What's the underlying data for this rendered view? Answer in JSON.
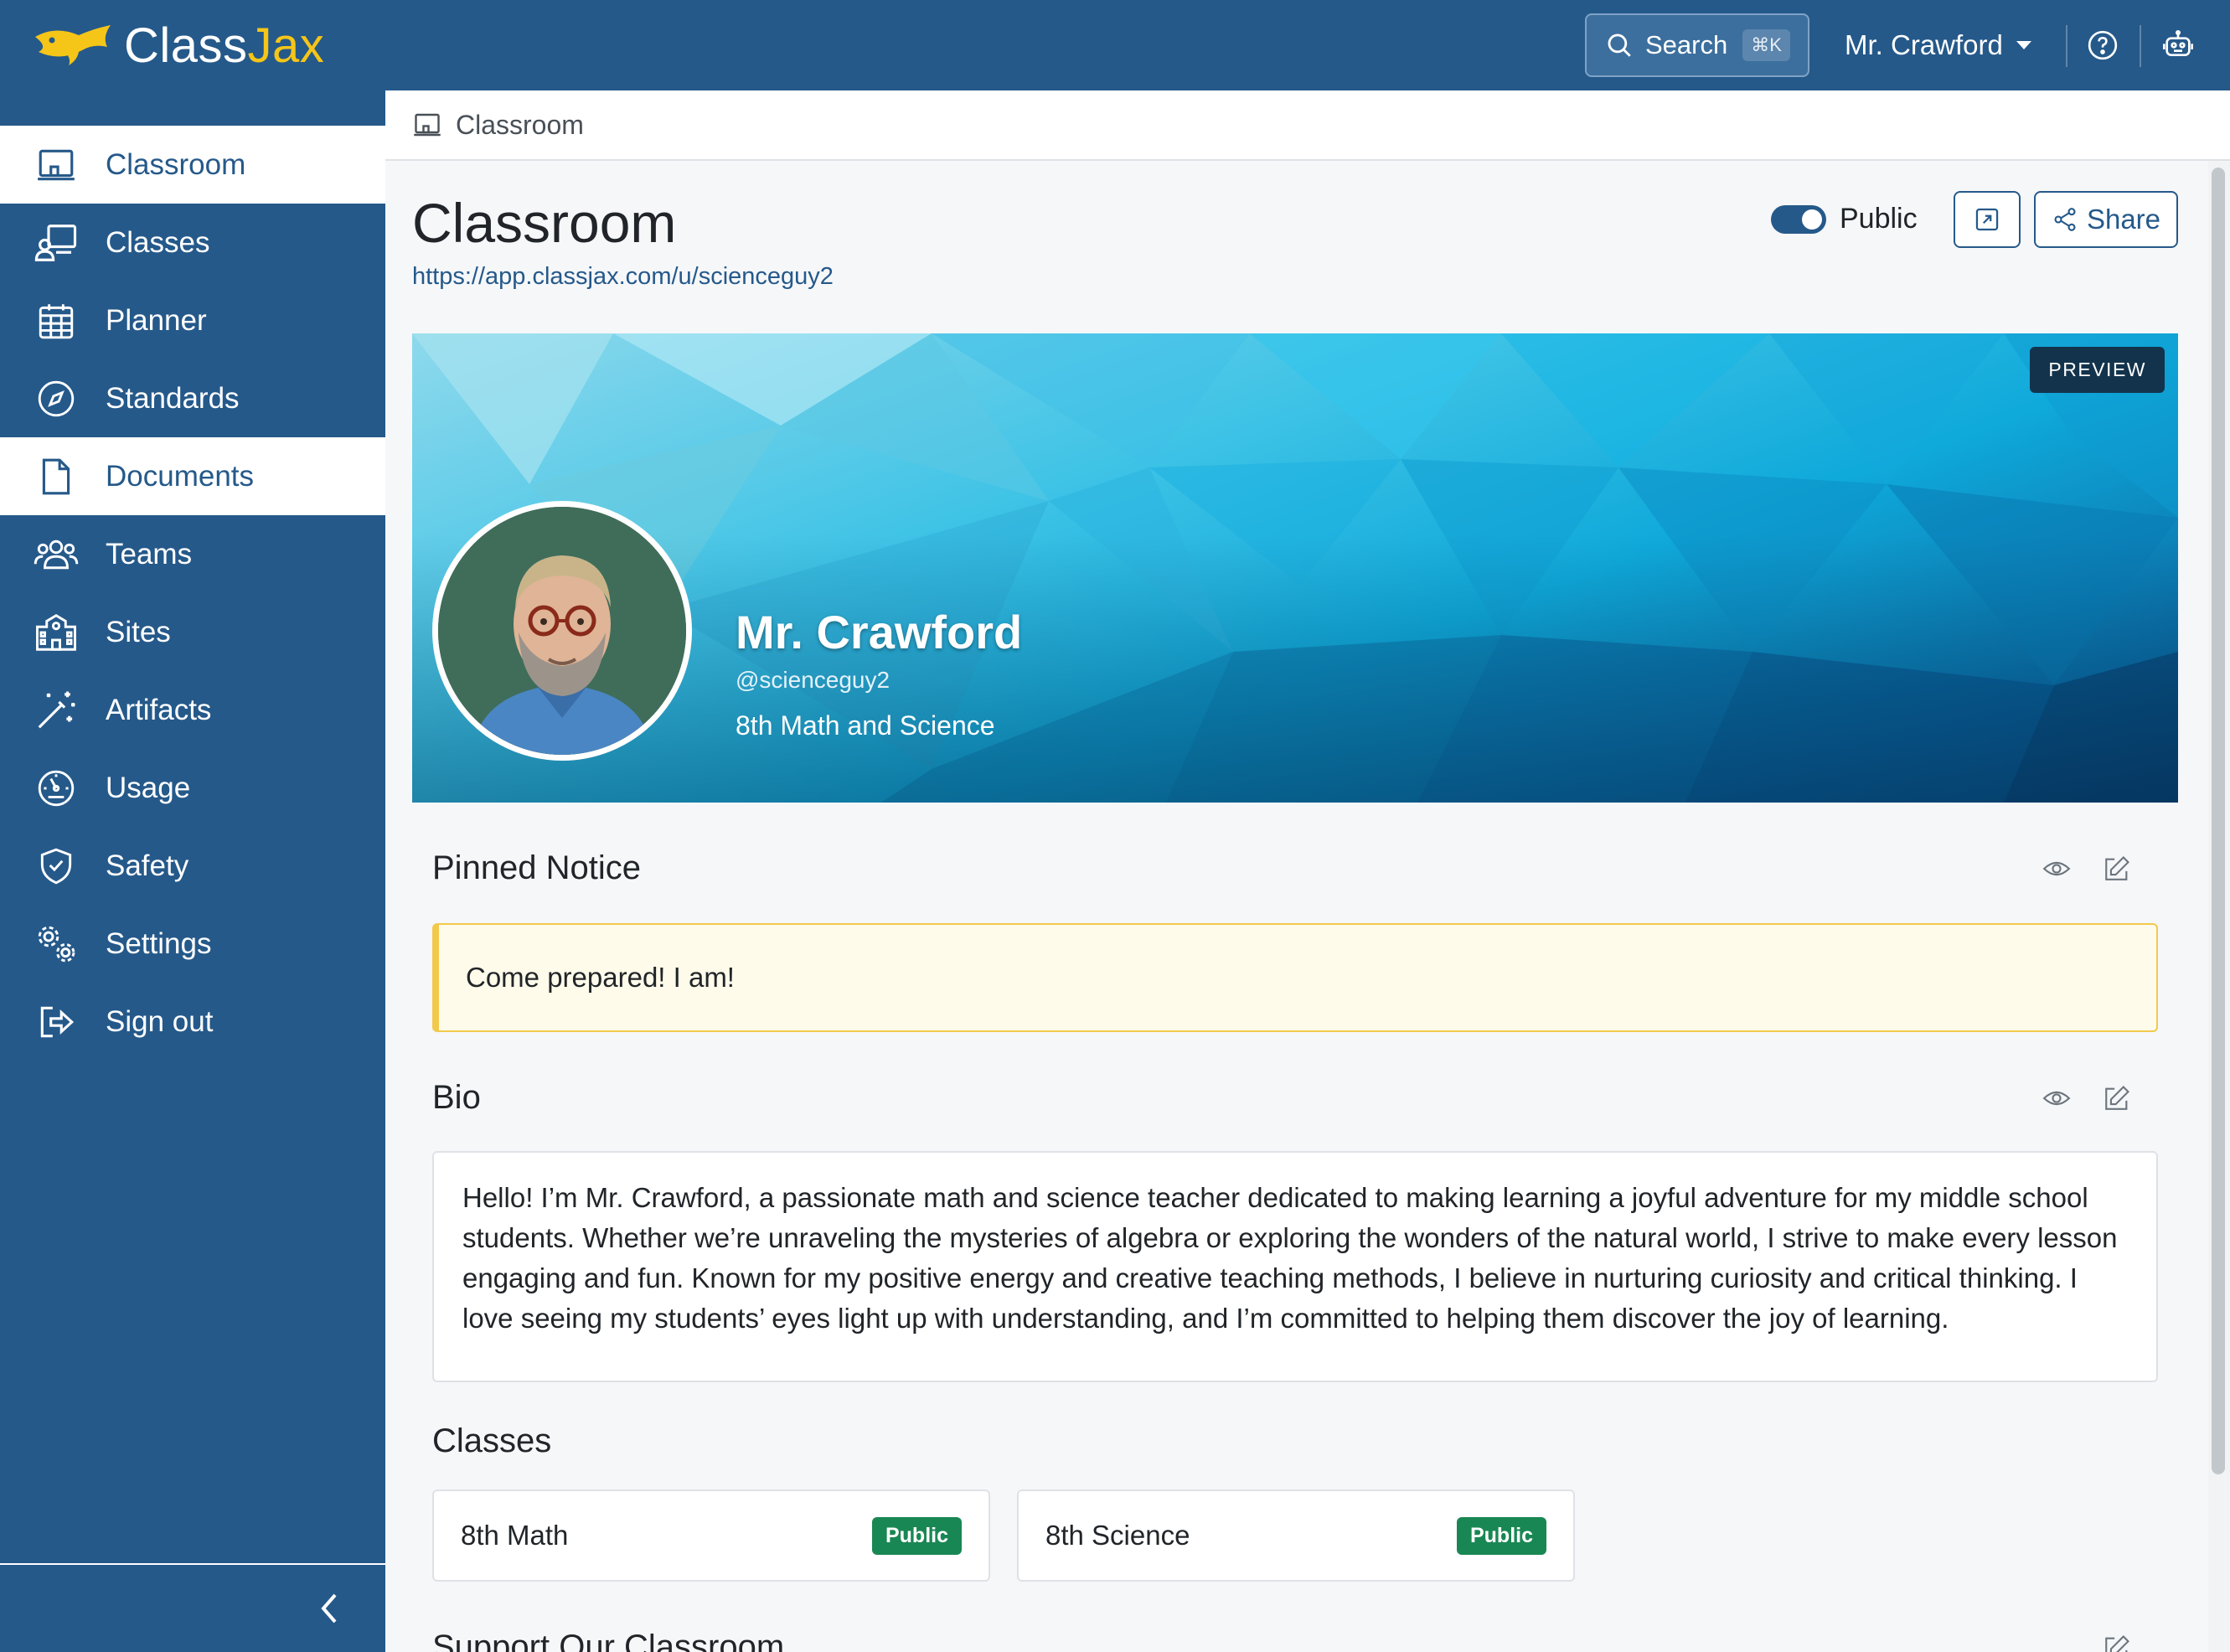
{
  "app": {
    "brand_part1": "Class",
    "brand_part2": "Jax",
    "brand_color": "#25598a",
    "accent_color": "#f5c518"
  },
  "topbar": {
    "search_label": "Search",
    "search_shortcut": "⌘K",
    "user_name": "Mr. Crawford",
    "icons": [
      "search-icon",
      "help-icon",
      "robot-icon"
    ]
  },
  "sidebar": {
    "items": [
      {
        "label": "Classroom",
        "icon": "classroom-icon",
        "active": true
      },
      {
        "label": "Classes",
        "icon": "classes-icon",
        "active": false
      },
      {
        "label": "Planner",
        "icon": "calendar-icon",
        "active": false
      },
      {
        "label": "Standards",
        "icon": "compass-icon",
        "active": false
      },
      {
        "label": "Documents",
        "icon": "document-icon",
        "active": true
      },
      {
        "label": "Teams",
        "icon": "teams-icon",
        "active": false
      },
      {
        "label": "Sites",
        "icon": "sites-icon",
        "active": false
      },
      {
        "label": "Artifacts",
        "icon": "magic-wand-icon",
        "active": false
      },
      {
        "label": "Usage",
        "icon": "gauge-icon",
        "active": false
      },
      {
        "label": "Safety",
        "icon": "shield-icon",
        "active": false
      },
      {
        "label": "Settings",
        "icon": "gears-icon",
        "active": false
      },
      {
        "label": "Sign out",
        "icon": "sign-out-icon",
        "active": false
      }
    ],
    "collapse_icon": "chevron-left-icon"
  },
  "breadcrumb": {
    "label": "Classroom"
  },
  "page": {
    "title": "Classroom",
    "url": "https://app.classjax.com/u/scienceguy2",
    "public_label": "Public",
    "public_on": true,
    "share_label": "Share"
  },
  "banner": {
    "preview_label": "PREVIEW",
    "name": "Mr. Crawford",
    "handle": "@scienceguy2",
    "subject": "8th Math and Science"
  },
  "pinned_notice": {
    "title": "Pinned Notice",
    "text": "Come prepared! I am!"
  },
  "bio": {
    "title": "Bio",
    "text": "Hello! I’m Mr. Crawford, a passionate math and science teacher dedicated to making learning a joyful adventure for my middle school students. Whether we’re unraveling the mysteries of algebra or exploring the wonders of the natural world, I strive to make every lesson engaging and fun. Known for my positive energy and creative teaching methods, I believe in nurturing curiosity and critical thinking. I love seeing my students’ eyes light up with understanding, and I’m committed to helping them discover the joy of learning."
  },
  "classes": {
    "title": "Classes",
    "items": [
      {
        "name": "8th Math",
        "badge": "Public"
      },
      {
        "name": "8th Science",
        "badge": "Public"
      }
    ]
  },
  "support": {
    "title": "Support Our Classroom"
  }
}
